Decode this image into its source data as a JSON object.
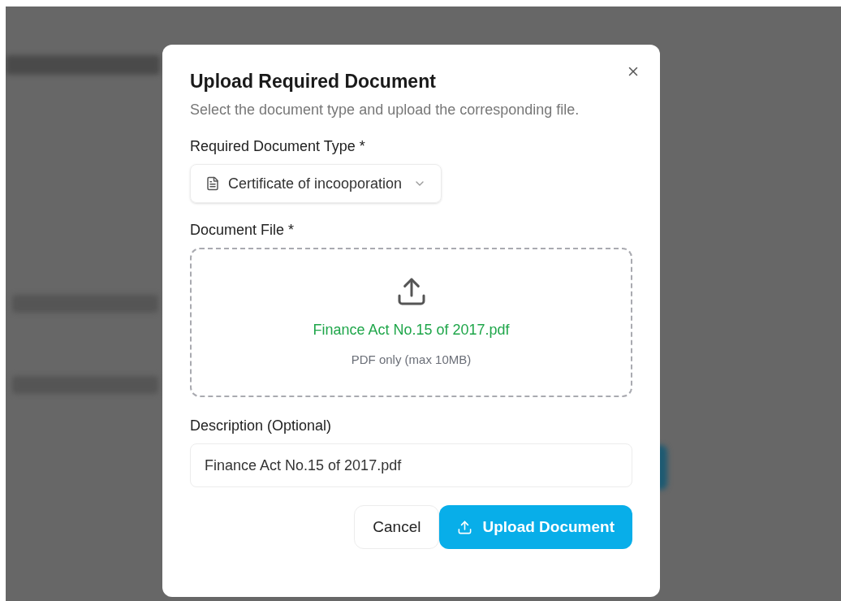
{
  "dialog": {
    "title": "Upload Required Document",
    "description": "Select the document type and upload the corresponding file.",
    "type_field": {
      "label": "Required Document Type *",
      "value": "Certificate of incooporation"
    },
    "file_field": {
      "label": "Document File *",
      "file_name": "Finance Act No.15 of 2017.pdf",
      "hint": "PDF only (max 10MB)"
    },
    "description_field": {
      "label": "Description (Optional)",
      "value": "Finance Act No.15 of 2017.pdf"
    },
    "buttons": [
      {
        "kind": "secondary",
        "label": "Cancel"
      },
      {
        "kind": "primary",
        "label": "Upload Document"
      }
    ]
  }
}
